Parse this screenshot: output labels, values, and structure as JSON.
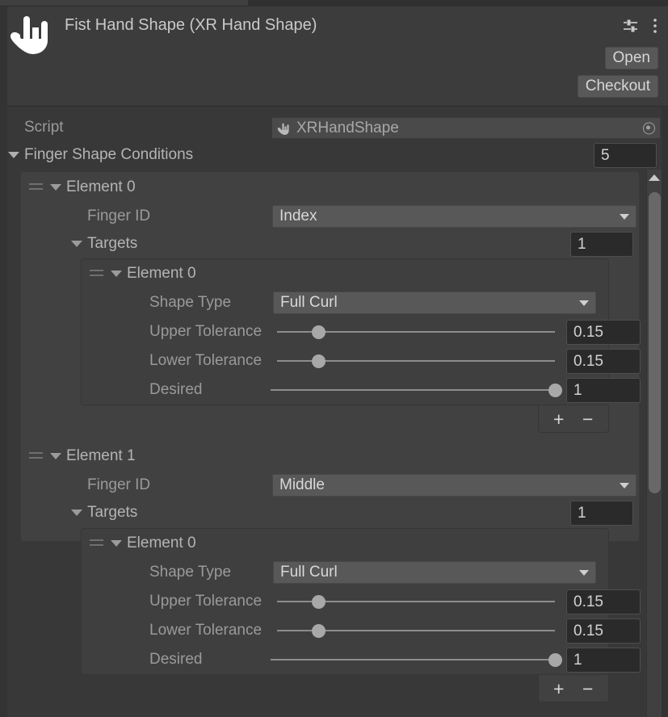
{
  "window": {
    "title": "Fist Hand Shape (XR Hand Shape)",
    "hand_icon": "hand-horns-icon",
    "preset_icon": "preset-sliders-icon",
    "kebab_icon": "kebab-menu-icon"
  },
  "header": {
    "open_label": "Open",
    "checkout_label": "Checkout"
  },
  "script": {
    "label": "Script",
    "value": "XRHandShape",
    "value_icon": "script-hand-icon",
    "picker_icon": "object-picker-icon"
  },
  "finger_shape_conditions": {
    "label": "Finger Shape Conditions",
    "count": "5",
    "foldout_icon": "caret-down-icon"
  },
  "list_footer": {
    "add_label": "+",
    "remove_label": "−",
    "add_icon": "plus-icon",
    "remove_icon": "minus-icon"
  },
  "labels": {
    "finger_id": "Finger ID",
    "targets": "Targets",
    "shape_type": "Shape Type",
    "upper_tolerance": "Upper Tolerance",
    "lower_tolerance": "Lower Tolerance",
    "desired": "Desired",
    "drag_handle_icon": "drag-handle-icon",
    "foldout_icon": "caret-down-icon",
    "dropdown_icon": "chevron-down-icon"
  },
  "elements": [
    {
      "name": "Element 0",
      "finger_id": "Index",
      "targets_label": "Targets",
      "targets_count": "1",
      "targets": [
        {
          "name": "Element 0",
          "shape_type": "Full Curl",
          "upper_tolerance": "0.15",
          "upper_tolerance_pct": 15,
          "lower_tolerance": "0.15",
          "lower_tolerance_pct": 15,
          "desired": "1",
          "desired_pct": 100
        }
      ]
    },
    {
      "name": "Element 1",
      "finger_id": "Middle",
      "targets_label": "Targets",
      "targets_count": "1",
      "targets": [
        {
          "name": "Element 0",
          "shape_type": "Full Curl",
          "upper_tolerance": "0.15",
          "upper_tolerance_pct": 15,
          "lower_tolerance": "0.15",
          "lower_tolerance_pct": 15,
          "desired": "1",
          "desired_pct": 100
        }
      ]
    }
  ],
  "scrollbar": {
    "up_arrow_icon": "caret-up-icon"
  },
  "colors": {
    "window_bg": "#383838",
    "header_bg": "#3c3c3c",
    "list_bg": "#414141",
    "inner_bg": "#3f3f3f",
    "field_bg": "#585858",
    "number_bg": "#2a2a2a",
    "text": "#c4c4c4"
  }
}
